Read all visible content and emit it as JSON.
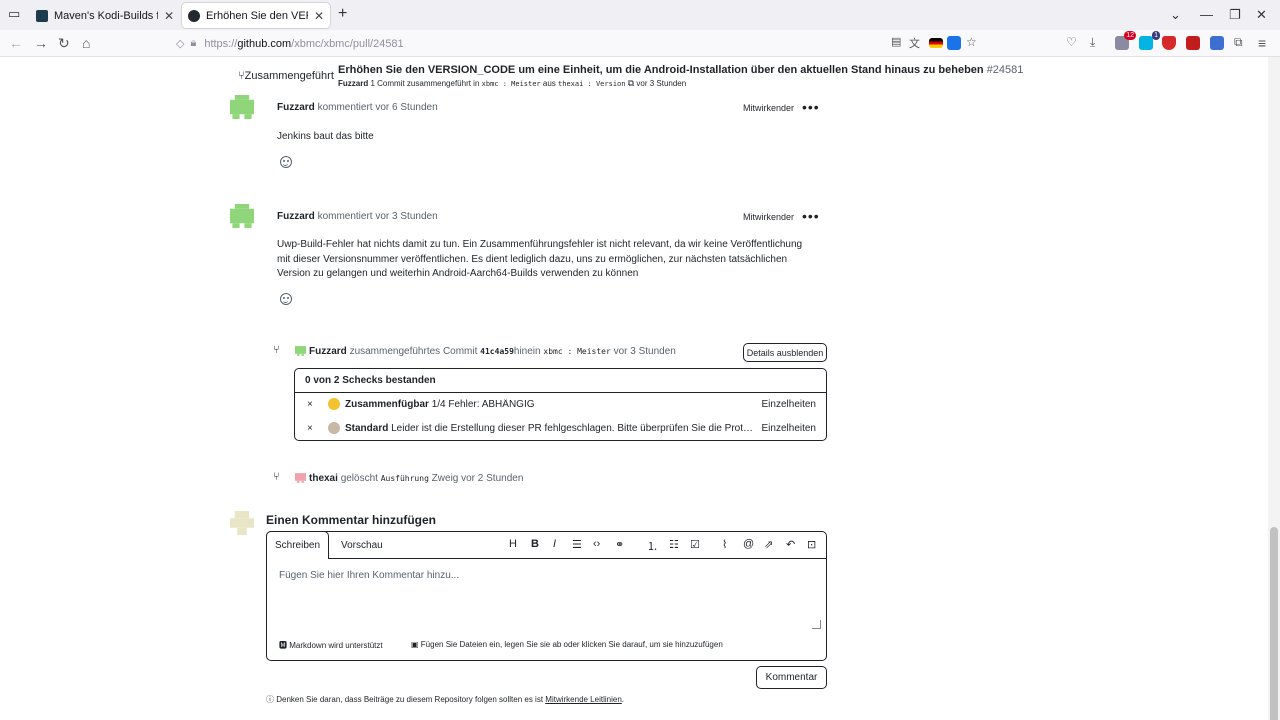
{
  "browser": {
    "tabs": [
      {
        "title": "Maven's Kodi-Builds für Androi",
        "active": false
      },
      {
        "title": "Erhöhen Sie den VERSION_COD",
        "active": true
      }
    ],
    "new_tab": "+",
    "url_prefix": "https://",
    "url_host": "github.com",
    "url_path": "/xbmc/xbmc/pull/24581",
    "badges": {
      "ext1": "12",
      "ext2": "1"
    }
  },
  "merged": {
    "label": "Zusammengeführt",
    "title": "Erhöhen Sie den VERSION_CODE um eine Einheit, um die Android-Installation über den aktuellen Stand hinaus zu beheben",
    "number": "#24581",
    "author": "Fuzzard",
    "summary": "1 Commit zusammengeführt in",
    "base_branch": "xbmc : Meister",
    "from_word": "aus",
    "head_branch": "thexai : Version",
    "time": "vor 3 Stunden"
  },
  "comments": [
    {
      "author": "Fuzzard",
      "action": "kommentiert",
      "time": "vor 6 Stunden",
      "role": "Mitwirkender",
      "more": "•••",
      "body": "Jenkins baut das bitte"
    },
    {
      "author": "Fuzzard",
      "action": "kommentiert",
      "time": "vor 3 Stunden",
      "role": "Mitwirkender",
      "more": "•••",
      "body": "Uwp-Build-Fehler hat nichts damit zu tun. Ein Zusammenführungsfehler ist nicht relevant, da wir keine Veröffentlichung mit dieser Versionsnummer veröffentlichen. Es dient lediglich dazu, uns zu ermöglichen, zur nächsten tatsächlichen Version zu gelangen und weiterhin Android-Aarch64-Builds verwenden zu können"
    }
  ],
  "merge_event": {
    "author": "Fuzzard",
    "action": "zusammengeführtes Commit",
    "commit": "41c4a59",
    "into": "hinein",
    "branch": "xbmc : Meister",
    "time": "vor 3 Stunden",
    "button": "Details ausblenden"
  },
  "checks": {
    "summary": "0 von 2 Schecks bestanden",
    "rows": [
      {
        "status": "×",
        "name": "Zusammenfügbar",
        "text": "1/4 Fehler: ABHÄNGIG",
        "link": "Einzelheiten"
      },
      {
        "status": "×",
        "name": "Standard",
        "text": "Leider ist die Erstellung dieser PR fehlgeschlagen. Bitte überprüfen Sie die Protokolle auf F...",
        "link": "Einzelheiten"
      }
    ]
  },
  "delete_event": {
    "author": "thexai",
    "action": "gelöscht",
    "branch": "Ausführung",
    "rest": "Zweig vor 2 Stunden"
  },
  "add_comment": {
    "title": "Einen Kommentar hinzufügen",
    "tab_write": "Schreiben",
    "tab_preview": "Vorschau",
    "placeholder": "Fügen Sie hier Ihren Kommentar hinzu...",
    "markdown_note": "Markdown wird unterstützt",
    "attach_note": "Fügen Sie Dateien ein, legen Sie sie ab oder klicken Sie darauf, um sie hinzuzufügen",
    "submit": "Kommentar",
    "toolbar": [
      "H",
      "B",
      "I"
    ]
  },
  "footer": {
    "text": "Denken Sie daran, dass Beiträge zu diesem Repository folgen sollten es ist",
    "link": "Mitwirkende Leitlinien",
    "end": "."
  }
}
